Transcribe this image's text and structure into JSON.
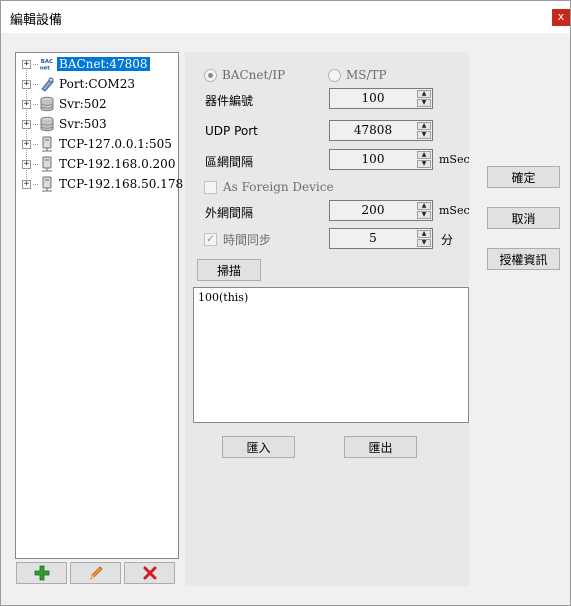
{
  "window": {
    "title": "編輯設備",
    "close_label": "x"
  },
  "tree": {
    "items": [
      {
        "label": "BACnet:47808",
        "icon": "bacnet-icon",
        "selected": true
      },
      {
        "label": "Port:COM23",
        "icon": "serial-port-icon",
        "selected": false
      },
      {
        "label": "Svr:502",
        "icon": "database-icon",
        "selected": false
      },
      {
        "label": "Svr:503",
        "icon": "database-icon",
        "selected": false
      },
      {
        "label": "TCP-127.0.0.1:505",
        "icon": "network-device-icon",
        "selected": false
      },
      {
        "label": "TCP-192.168.0.200",
        "icon": "network-device-icon",
        "selected": false
      },
      {
        "label": "TCP-192.168.50.178",
        "icon": "network-device-icon",
        "selected": false
      }
    ],
    "expander": "+",
    "buttons": {
      "add": "plus-icon",
      "edit": "pencil-icon",
      "delete": "delete-x-icon"
    }
  },
  "settings": {
    "protocol": {
      "bacnet_ip": "BACnet/IP",
      "ms_tp": "MS/TP",
      "selected": "BACnet/IP"
    },
    "device_id": {
      "label": "器件編號",
      "value": "100"
    },
    "udp_port": {
      "label": "UDP Port",
      "value": "47808"
    },
    "local_interval": {
      "label": "區網間隔",
      "value": "100",
      "unit": "mSec"
    },
    "foreign_device": {
      "label": "As Foreign Device",
      "checked": false
    },
    "remote_interval": {
      "label": "外網間隔",
      "value": "200",
      "unit": "mSec"
    },
    "time_sync": {
      "label": "時間同步",
      "value": "5",
      "unit": "分",
      "checked": true
    },
    "scan_label": "掃描",
    "results": [
      "100(this)"
    ],
    "import_label": "匯入",
    "export_label": "匯出"
  },
  "actions": {
    "ok": "確定",
    "cancel": "取消",
    "license": "授權資訊"
  },
  "spinner": {
    "up": "▲",
    "down": "▼"
  },
  "colors": {
    "selection": "#0078d7",
    "close": "#c42b1c",
    "add": "#2e9e2e",
    "delete": "#d01c1c",
    "edit": "#e8782a"
  }
}
